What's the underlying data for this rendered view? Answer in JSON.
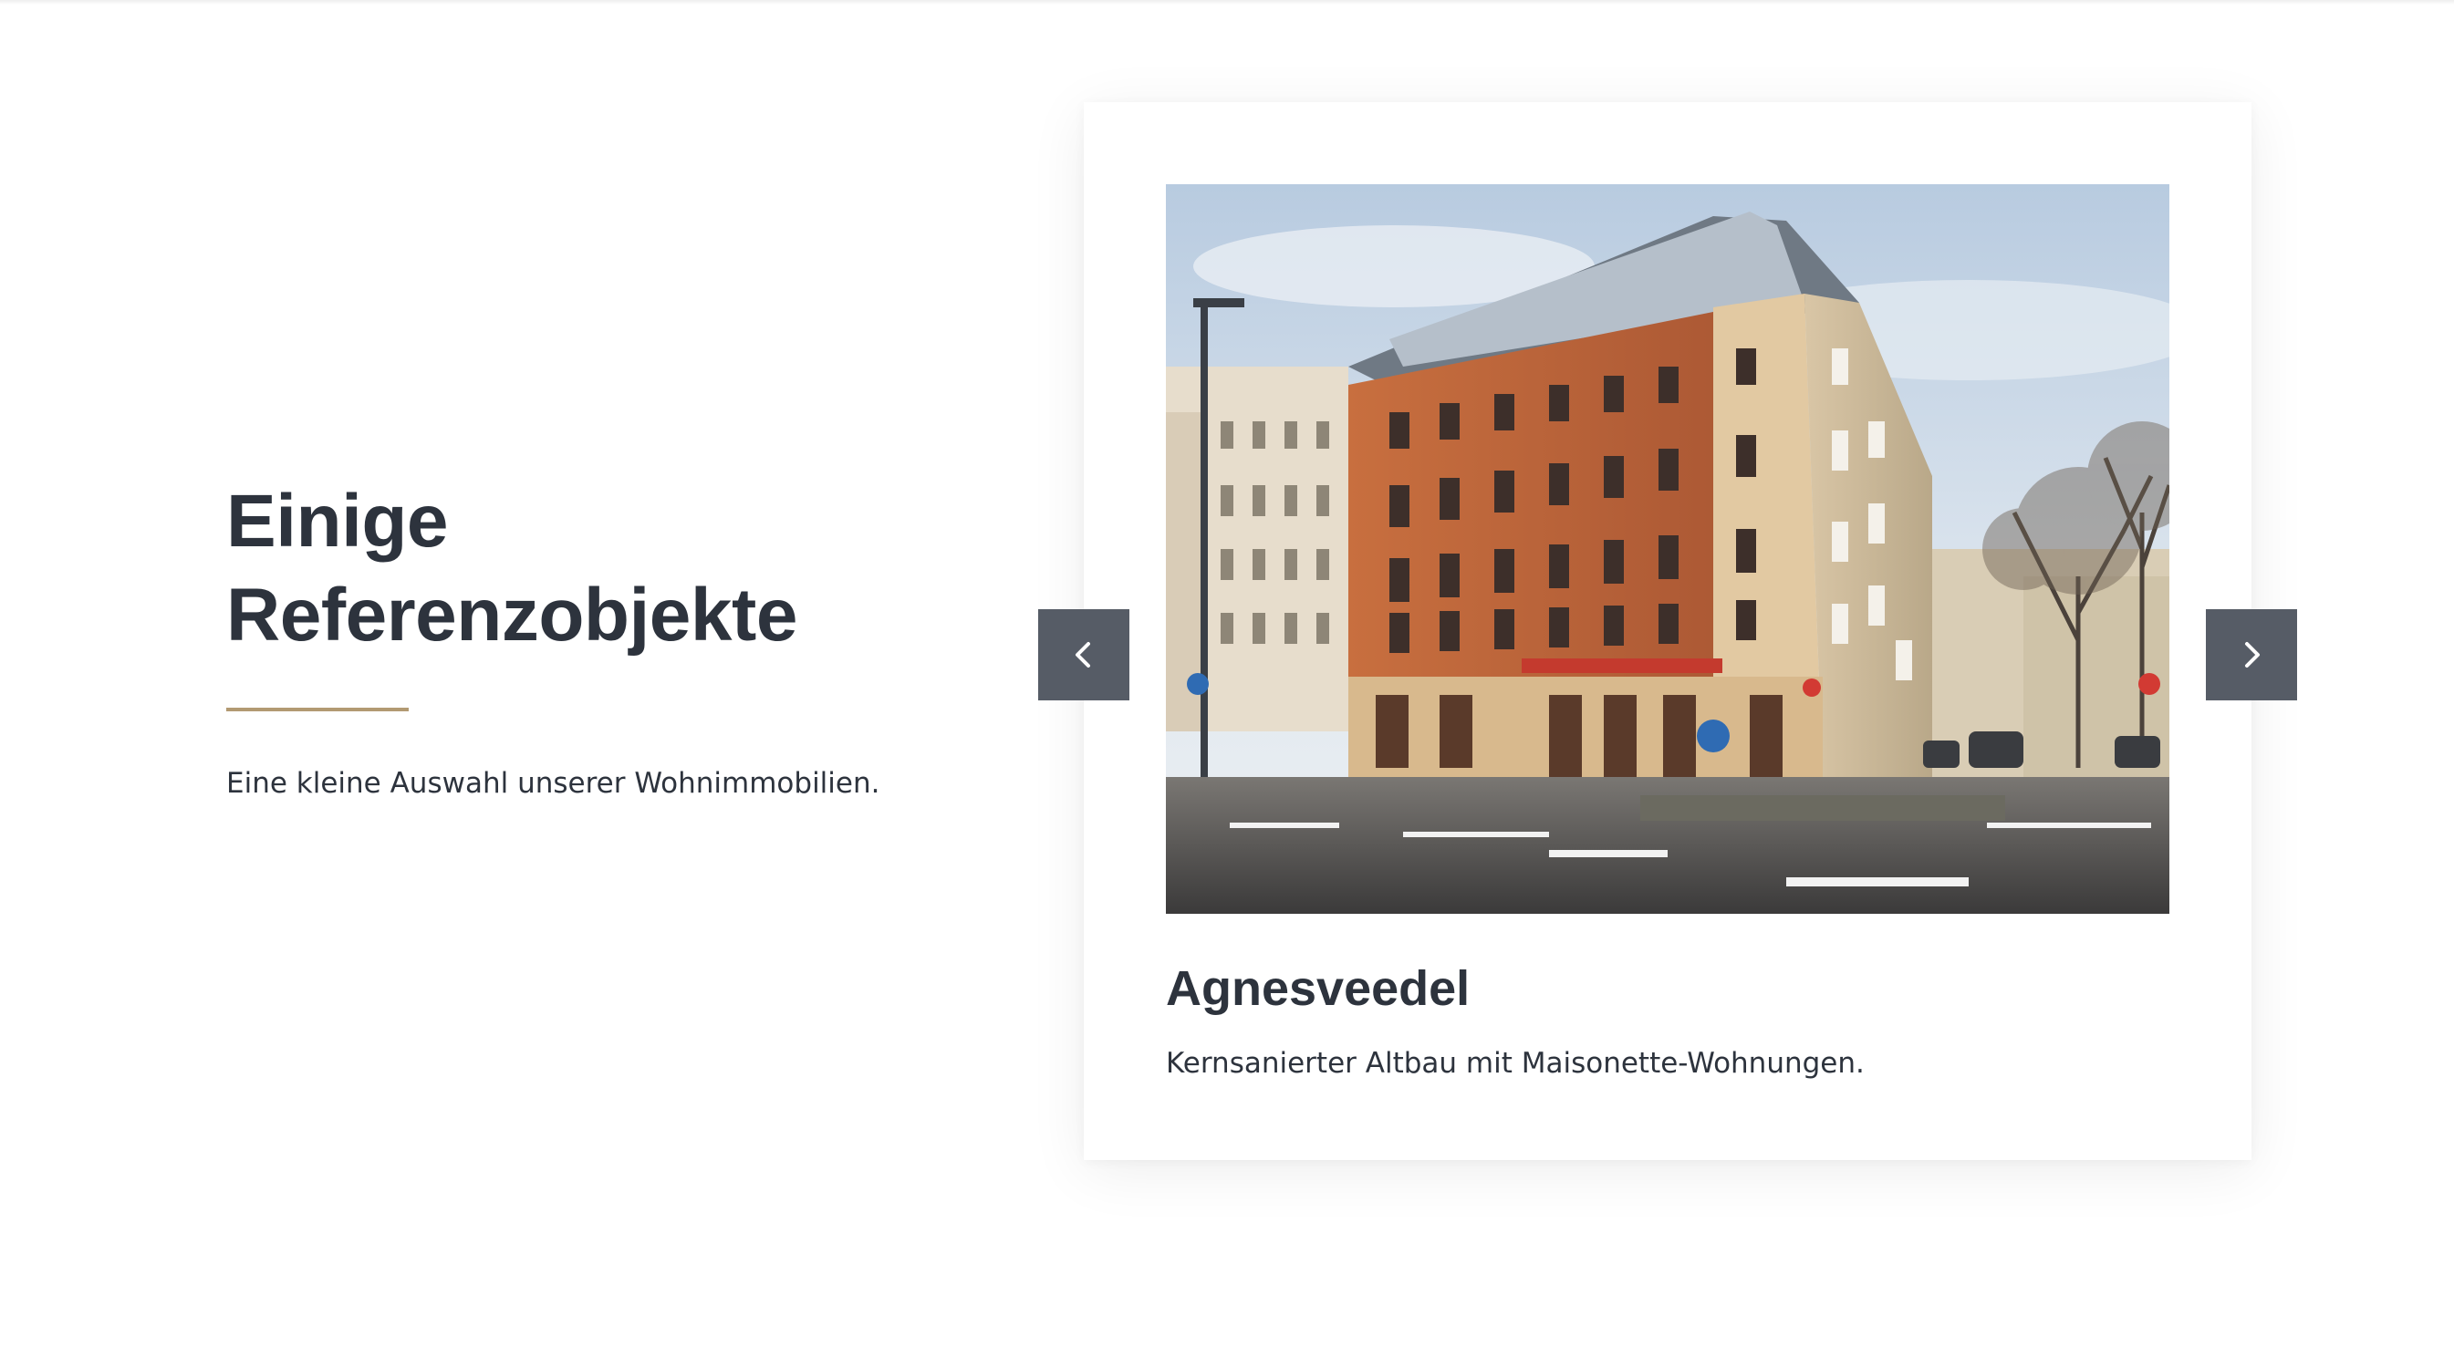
{
  "intro": {
    "title_line1": "Einige",
    "title_line2": "Referenzobjekte",
    "description": "Eine kleine Auswahl unserer Wohnimmobilien."
  },
  "slider": {
    "prev_icon": "chevron-left-icon",
    "next_icon": "chevron-right-icon",
    "current_slide": {
      "image_alt": "Agnesveedel",
      "title": "Agnesveedel",
      "description": "Kernsanierter Altbau mit Maisonette-Wohnungen."
    }
  },
  "colors": {
    "text": "#2d333d",
    "accent_gold": "#b29a72",
    "arrow_bg": "#565c66",
    "background": "#ffffff"
  }
}
